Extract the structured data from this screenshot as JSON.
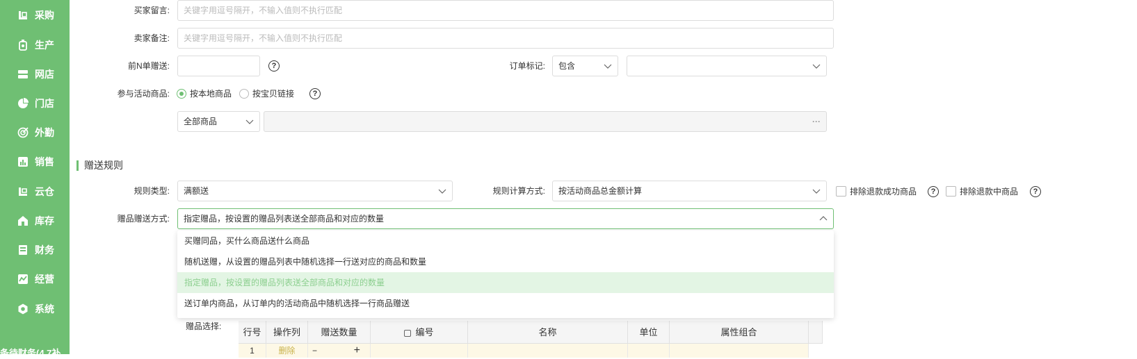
{
  "sidebar": {
    "items": [
      {
        "label": "采购",
        "icon": "purchase-icon"
      },
      {
        "label": "生产",
        "icon": "production-icon"
      },
      {
        "label": "网店",
        "icon": "store-icon"
      },
      {
        "label": "门店",
        "icon": "shop-icon"
      },
      {
        "label": "外勤",
        "icon": "field-icon"
      },
      {
        "label": "销售",
        "icon": "sales-icon"
      },
      {
        "label": "云仓",
        "icon": "warehouse-icon"
      },
      {
        "label": "库存",
        "icon": "inventory-icon"
      },
      {
        "label": "财务",
        "icon": "finance-icon"
      },
      {
        "label": "经营",
        "icon": "operations-icon"
      },
      {
        "label": "系统",
        "icon": "system-icon"
      }
    ],
    "footer": "条待财务(4.7补"
  },
  "form": {
    "buyer_message": {
      "label": "买家留言:",
      "placeholder": "关键字用逗号隔开，不输入值则不执行匹配"
    },
    "seller_note": {
      "label": "卖家备注:",
      "placeholder": "关键字用逗号隔开，不输入值则不执行匹配"
    },
    "first_n": {
      "label": "前N单赠送:",
      "value": ""
    },
    "order_mark": {
      "label": "订单标记:",
      "operator": "包含",
      "value": ""
    },
    "activity_goods": {
      "label": "参与活动商品:",
      "options": [
        "按本地商品",
        "按宝贝链接"
      ],
      "selected": "按本地商品",
      "scope": "全部商品",
      "picker_value": "",
      "more": "···"
    }
  },
  "rules": {
    "title": "赠送规则",
    "rule_type": {
      "label": "规则类型:",
      "value": "满额送"
    },
    "calc_method": {
      "label": "规则计算方式:",
      "value": "按活动商品总金额计算"
    },
    "exclude_refund_success": "排除退款成功商品",
    "exclude_refunding": "排除退款中商品",
    "gift_method": {
      "label": "赠品赠送方式:",
      "value": "指定赠品，按设置的赠品列表送全部商品和对应的数量",
      "options": [
        "买赠同品，买什么商品送什么商品",
        "随机送赠，从设置的赠品列表中随机选择一行送对应的商品和数量",
        "指定赠品，按设置的赠品列表送全部商品和对应的数量",
        "送订单内商品，从订单内的活动商品中随机选择一行商品赠送"
      ]
    },
    "gift_select_label": "赠品选择:"
  },
  "table": {
    "headers": [
      "行号",
      "操作列",
      "赠送数量",
      "编号",
      "名称",
      "单位",
      "属性组合"
    ],
    "rows": [
      {
        "row_no": "1",
        "action": "删除",
        "qty_minus": "−",
        "qty_plus": "+"
      }
    ]
  },
  "colors": {
    "accent": "#6fbf73",
    "selected_bg": "#e3f5e4",
    "row_bg": "#fdf8e6"
  }
}
